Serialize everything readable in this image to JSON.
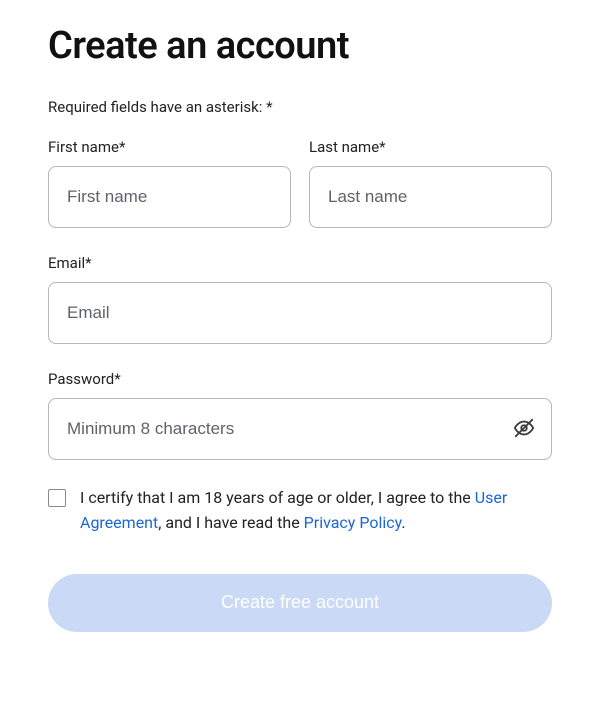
{
  "heading": "Create an account",
  "required_note": "Required fields have an asterisk: *",
  "fields": {
    "first_name": {
      "label": "First name*",
      "placeholder": "First name",
      "value": ""
    },
    "last_name": {
      "label": "Last name*",
      "placeholder": "Last name",
      "value": ""
    },
    "email": {
      "label": "Email*",
      "placeholder": "Email",
      "value": ""
    },
    "password": {
      "label": "Password*",
      "placeholder": "Minimum 8 characters",
      "value": ""
    }
  },
  "consent": {
    "checked": false,
    "prefix": "I certify that I am 18 years of age or older, I agree to the ",
    "user_agreement": "User Agreement",
    "middle": ", and I have read the ",
    "privacy_policy": "Privacy Policy",
    "suffix": "."
  },
  "submit_label": "Create free account",
  "submit_enabled": false
}
